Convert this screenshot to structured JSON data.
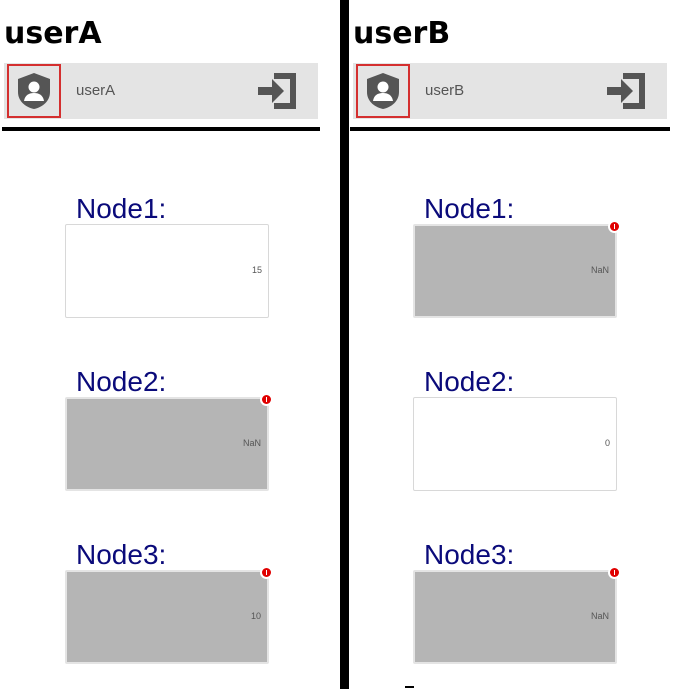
{
  "panels": [
    {
      "title": "userA",
      "username": "userA",
      "nodes": [
        {
          "label": "Node1:",
          "value": "15",
          "status": "ok"
        },
        {
          "label": "Node2:",
          "value": "NaN",
          "status": "error"
        },
        {
          "label": "Node3:",
          "value": "10",
          "status": "error"
        }
      ]
    },
    {
      "title": "userB",
      "username": "userB",
      "nodes": [
        {
          "label": "Node1:",
          "value": "NaN",
          "status": "error"
        },
        {
          "label": "Node2:",
          "value": "0",
          "status": "ok"
        },
        {
          "label": "Node3:",
          "value": "NaN",
          "status": "error"
        }
      ]
    }
  ],
  "icons": {
    "avatar": "user-shield-icon",
    "logout": "sign-in-arrow-icon",
    "error": "error-badge-icon"
  },
  "colors": {
    "node_label": "#0a0a7a",
    "error_badge": "#e00000",
    "avatar_border": "#d42f2f",
    "error_fill": "#b5b5b5"
  }
}
